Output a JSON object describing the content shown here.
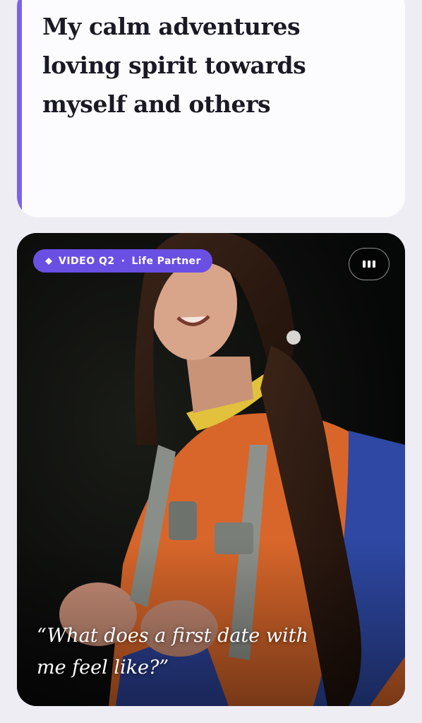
{
  "prompt_card": {
    "answer": "My calm adventures loving spirit towards myself and others",
    "accent_color": "#7b63e8"
  },
  "video_card": {
    "badge": {
      "icon": "diamond-icon",
      "label": "VIDEO Q2",
      "separator": "·",
      "category": "Life Partner",
      "color": "#6a4fe3"
    },
    "audio_button": {
      "icon": "audio-bars-icon"
    },
    "quote": "“What does a first date with me feel like?”"
  }
}
